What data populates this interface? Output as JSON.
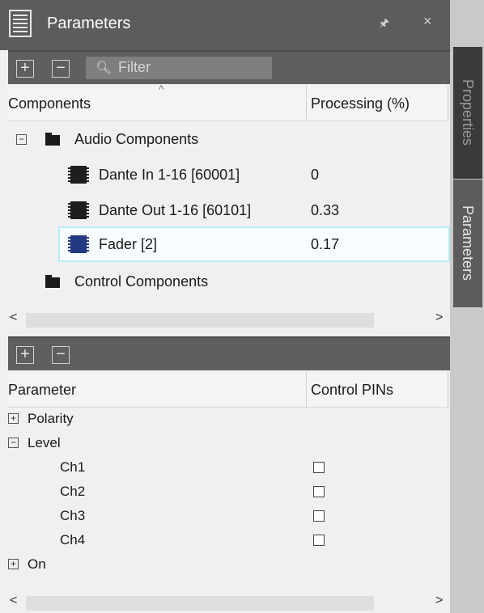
{
  "window": {
    "title": "Parameters"
  },
  "side_tabs": {
    "properties": "Properties",
    "parameters": "Parameters"
  },
  "top_toolbar": {
    "filter_placeholder": "Filter"
  },
  "components_table": {
    "col_components": "Components",
    "col_processing": "Processing (%)",
    "rows": [
      {
        "label": "Audio Components",
        "value": ""
      },
      {
        "label": "Dante In 1-16 [60001]",
        "value": "0"
      },
      {
        "label": "Dante Out 1-16 [60101]",
        "value": "0.33"
      },
      {
        "label": "Fader [2]",
        "value": "0.17"
      },
      {
        "label": "Control Components",
        "value": ""
      }
    ]
  },
  "parameters_table": {
    "col_parameter": "Parameter",
    "col_control_pins": "Control PINs",
    "rows": [
      {
        "label": "Polarity"
      },
      {
        "label": "Level"
      },
      {
        "label": "Ch1"
      },
      {
        "label": "Ch2"
      },
      {
        "label": "Ch3"
      },
      {
        "label": "Ch4"
      },
      {
        "label": "On"
      }
    ]
  },
  "colors": {
    "titlebar": "#5c5c5c",
    "selection_border": "#b9ecf6",
    "chip_selected": "#233a82"
  }
}
